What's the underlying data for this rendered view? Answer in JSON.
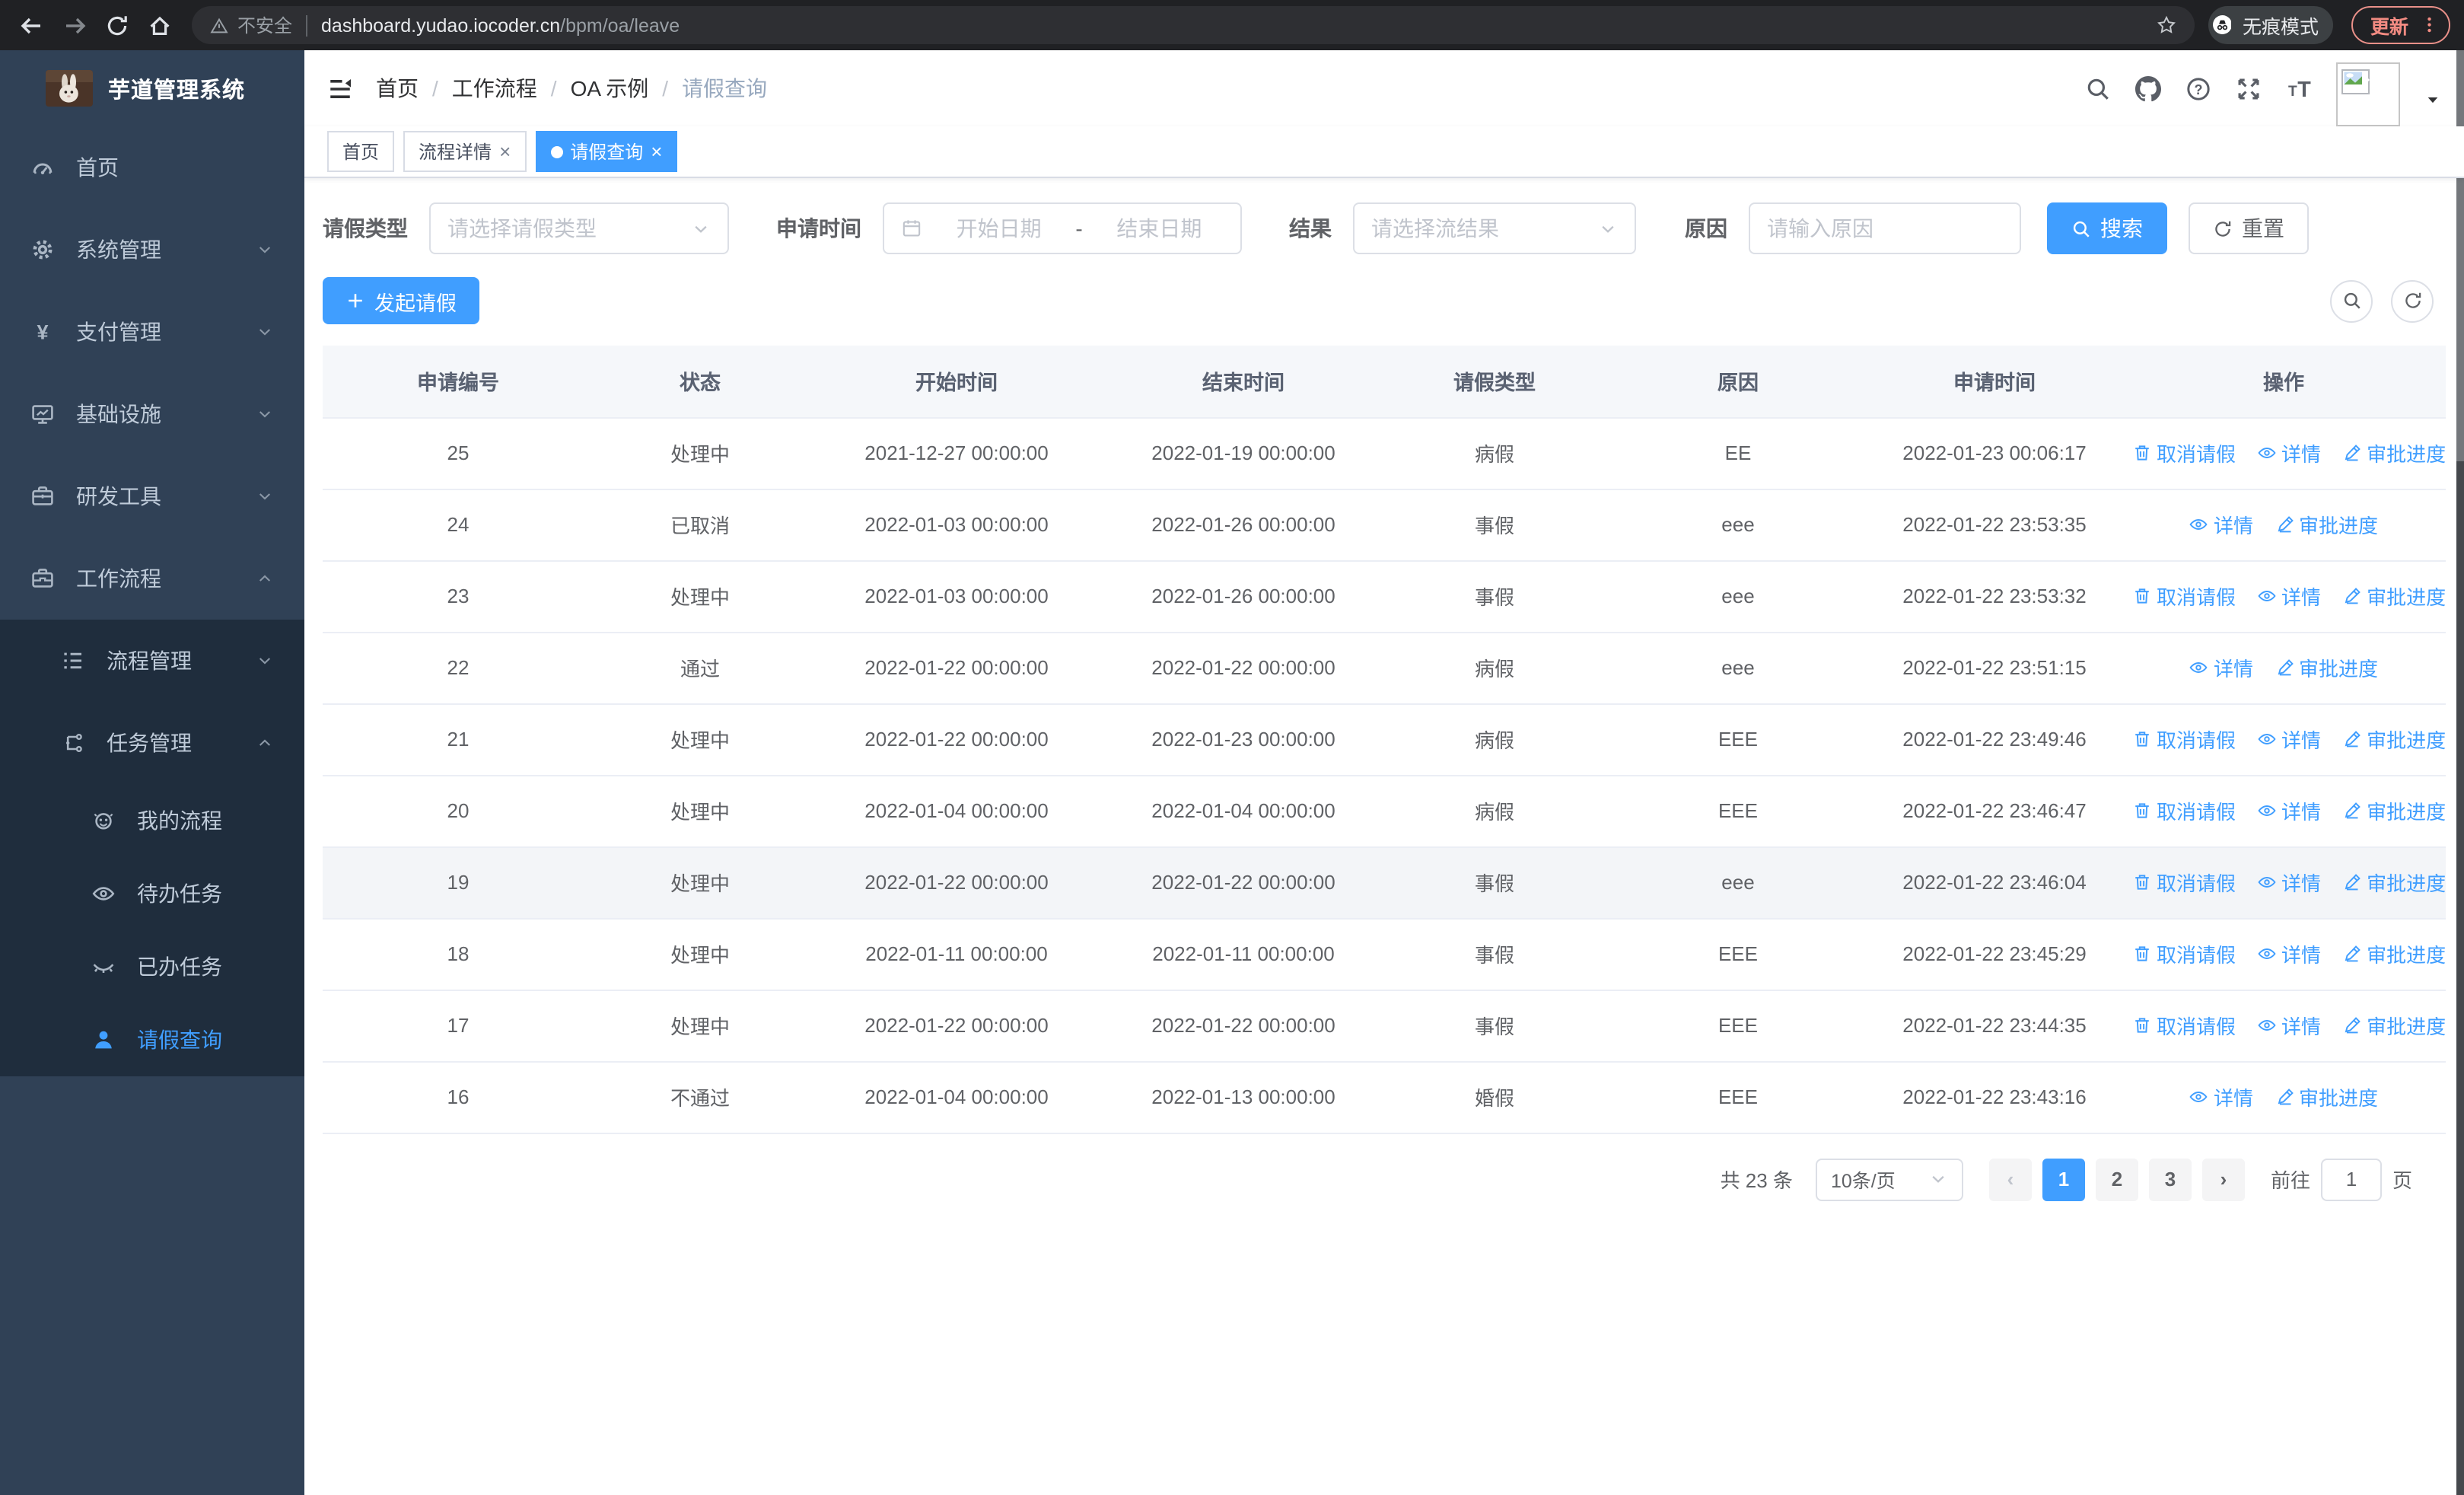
{
  "browser": {
    "security_label": "不安全",
    "url_host": "dashboard.yudao.iocoder.cn",
    "url_path": "/bpm/oa/leave",
    "incognito_label": "无痕模式",
    "update_label": "更新"
  },
  "sidebar": {
    "title": "芋道管理系统",
    "menu": [
      {
        "name": "home",
        "icon": "dashboard-icon",
        "label": "首页"
      },
      {
        "name": "system-management",
        "icon": "gear-icon",
        "label": "系统管理",
        "chevron": "down"
      },
      {
        "name": "payment-management",
        "icon": "yen-icon",
        "label": "支付管理",
        "chevron": "down"
      },
      {
        "name": "infrastructure",
        "icon": "monitor-icon",
        "label": "基础设施",
        "chevron": "down"
      },
      {
        "name": "dev-tools",
        "icon": "toolbox-icon",
        "label": "研发工具",
        "chevron": "down"
      },
      {
        "name": "workflow",
        "icon": "briefcase-icon",
        "label": "工作流程",
        "chevron": "up",
        "children": [
          {
            "name": "process-management",
            "icon": "list-tree-icon",
            "label": "流程管理",
            "chevron": "down"
          },
          {
            "name": "task-management",
            "icon": "flow-tree-icon",
            "label": "任务管理",
            "chevron": "up",
            "children": [
              {
                "name": "my-process",
                "icon": "chat-face-icon",
                "label": "我的流程"
              },
              {
                "name": "todo-tasks",
                "icon": "eye-open-icon",
                "label": "待办任务"
              },
              {
                "name": "done-tasks",
                "icon": "eye-closed-icon",
                "label": "已办任务"
              },
              {
                "name": "leave-query",
                "icon": "user-icon",
                "label": "请假查询",
                "active": true
              }
            ]
          }
        ]
      }
    ]
  },
  "breadcrumb": [
    "首页",
    "工作流程",
    "OA 示例",
    "请假查询"
  ],
  "tabs": [
    {
      "name": "tab-home",
      "label": "首页"
    },
    {
      "name": "tab-process-detail",
      "label": "流程详情",
      "closable": true
    },
    {
      "name": "tab-leave-query",
      "label": "请假查询",
      "closable": true,
      "active": true
    }
  ],
  "filters": {
    "leave_type_label": "请假类型",
    "leave_type_placeholder": "请选择请假类型",
    "apply_time_label": "申请时间",
    "start_placeholder": "开始日期",
    "range_separator": "-",
    "end_placeholder": "结束日期",
    "result_label": "结果",
    "result_placeholder": "请选择流结果",
    "reason_label": "原因",
    "reason_placeholder": "请输入原因",
    "search_label": "搜索",
    "reset_label": "重置"
  },
  "toolbar": {
    "create_label": "发起请假"
  },
  "table": {
    "columns": [
      "申请编号",
      "状态",
      "开始时间",
      "结束时间",
      "请假类型",
      "原因",
      "申请时间",
      "操作"
    ],
    "action_labels": {
      "cancel": "取消请假",
      "detail": "详情",
      "progress": "审批进度"
    },
    "rows": [
      {
        "id": "25",
        "status": "处理中",
        "start": "2021-12-27 00:00:00",
        "end": "2022-01-19 00:00:00",
        "type": "病假",
        "reason": "EE",
        "apply_time": "2022-01-23 00:06:17",
        "actions": [
          "取消请假",
          "详情",
          "审批进度"
        ]
      },
      {
        "id": "24",
        "status": "已取消",
        "start": "2022-01-03 00:00:00",
        "end": "2022-01-26 00:00:00",
        "type": "事假",
        "reason": "eee",
        "apply_time": "2022-01-22 23:53:35",
        "actions": [
          "详情",
          "审批进度"
        ]
      },
      {
        "id": "23",
        "status": "处理中",
        "start": "2022-01-03 00:00:00",
        "end": "2022-01-26 00:00:00",
        "type": "事假",
        "reason": "eee",
        "apply_time": "2022-01-22 23:53:32",
        "actions": [
          "取消请假",
          "详情",
          "审批进度"
        ]
      },
      {
        "id": "22",
        "status": "通过",
        "start": "2022-01-22 00:00:00",
        "end": "2022-01-22 00:00:00",
        "type": "病假",
        "reason": "eee",
        "apply_time": "2022-01-22 23:51:15",
        "actions": [
          "详情",
          "审批进度"
        ]
      },
      {
        "id": "21",
        "status": "处理中",
        "start": "2022-01-22 00:00:00",
        "end": "2022-01-23 00:00:00",
        "type": "病假",
        "reason": "EEE",
        "apply_time": "2022-01-22 23:49:46",
        "actions": [
          "取消请假",
          "详情",
          "审批进度"
        ]
      },
      {
        "id": "20",
        "status": "处理中",
        "start": "2022-01-04 00:00:00",
        "end": "2022-01-04 00:00:00",
        "type": "病假",
        "reason": "EEE",
        "apply_time": "2022-01-22 23:46:47",
        "actions": [
          "取消请假",
          "详情",
          "审批进度"
        ]
      },
      {
        "id": "19",
        "status": "处理中",
        "start": "2022-01-22 00:00:00",
        "end": "2022-01-22 00:00:00",
        "type": "事假",
        "reason": "eee",
        "apply_time": "2022-01-22 23:46:04",
        "actions": [
          "取消请假",
          "详情",
          "审批进度"
        ],
        "highlighted": true
      },
      {
        "id": "18",
        "status": "处理中",
        "start": "2022-01-11 00:00:00",
        "end": "2022-01-11 00:00:00",
        "type": "事假",
        "reason": "EEE",
        "apply_time": "2022-01-22 23:45:29",
        "actions": [
          "取消请假",
          "详情",
          "审批进度"
        ]
      },
      {
        "id": "17",
        "status": "处理中",
        "start": "2022-01-22 00:00:00",
        "end": "2022-01-22 00:00:00",
        "type": "事假",
        "reason": "EEE",
        "apply_time": "2022-01-22 23:44:35",
        "actions": [
          "取消请假",
          "详情",
          "审批进度"
        ]
      },
      {
        "id": "16",
        "status": "不通过",
        "start": "2022-01-04 00:00:00",
        "end": "2022-01-13 00:00:00",
        "type": "婚假",
        "reason": "EEE",
        "apply_time": "2022-01-22 23:43:16",
        "actions": [
          "详情",
          "审批进度"
        ]
      }
    ]
  },
  "pagination": {
    "total_label": "共 23 条",
    "page_size": "10条/页",
    "prev": "‹",
    "next": "›",
    "pages": [
      "1",
      "2",
      "3"
    ],
    "active_page": "1",
    "goto_label": "前往",
    "goto_value": "1",
    "goto_suffix": "页"
  },
  "colors": {
    "primary": "#409eff",
    "sidebar_bg": "#304156",
    "submenu_bg": "#1f2d3d",
    "update_accent": "#f28b82"
  }
}
